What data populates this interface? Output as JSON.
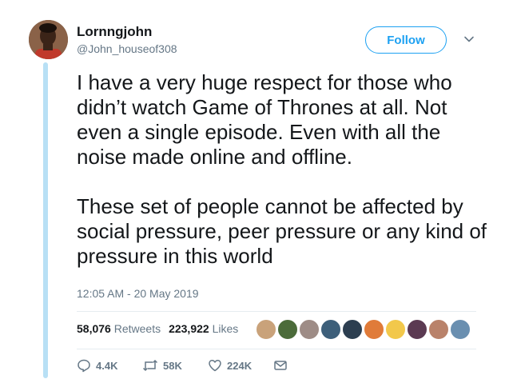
{
  "author": {
    "name": "Lornngjohn",
    "handle": "@John_houseof308"
  },
  "follow_label": "Follow",
  "tweet": {
    "paragraph1": "I have a very huge respect for those who didn’t watch Game of Thrones at all. Not even a single episode. Even with all the noise made online and offline.",
    "paragraph2": "These set of people cannot be affected by social pressure, peer pressure or any kind of pressure in this world",
    "timestamp": "12:05 AM - 20 May 2019"
  },
  "stats": {
    "retweets_count": "58,076",
    "retweets_label": "Retweets",
    "likes_count": "223,922",
    "likes_label": "Likes"
  },
  "liker_avatars": [
    {
      "icon": "avatar-face",
      "color": "#c9a27a"
    },
    {
      "icon": "avatar-face",
      "color": "#4b6b3a"
    },
    {
      "icon": "avatar-face",
      "color": "#9e8c86"
    },
    {
      "icon": "avatar-face",
      "color": "#3d5f7a"
    },
    {
      "icon": "avatar-face",
      "color": "#2c3e50"
    },
    {
      "icon": "avatar-face",
      "color": "#e07b39"
    },
    {
      "icon": "avatar-face",
      "color": "#f2c84b"
    },
    {
      "icon": "avatar-face",
      "color": "#5b3a52"
    },
    {
      "icon": "avatar-face",
      "color": "#b9826a"
    },
    {
      "icon": "avatar-face",
      "color": "#6a8fb0"
    }
  ],
  "actions": {
    "reply_count": "4.4K",
    "retweet_count": "58K",
    "like_count": "224K"
  },
  "colors": {
    "accent": "#1da1f2",
    "secondary_text": "#657786",
    "thread_line": "#b8e0f5"
  }
}
